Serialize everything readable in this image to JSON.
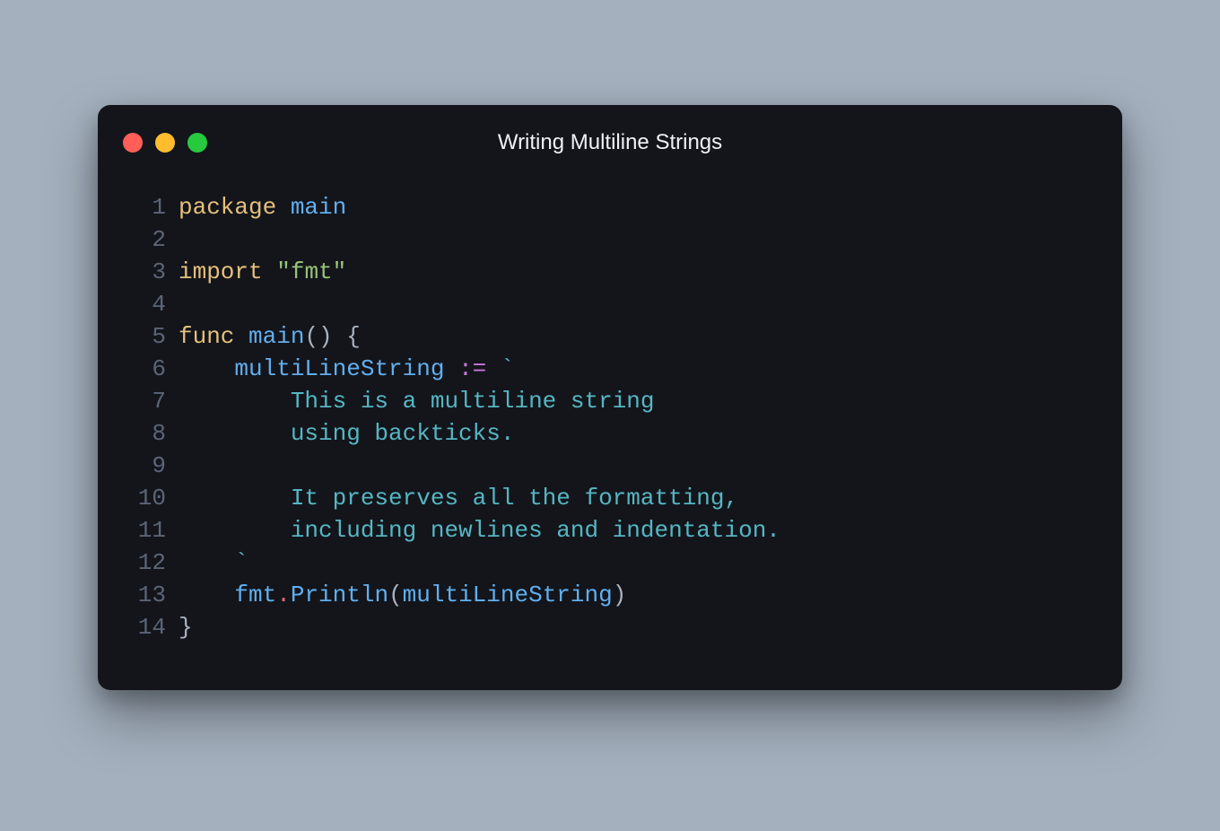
{
  "window": {
    "title": "Writing Multiline Strings",
    "traffic_light_colors": {
      "close": "#ff5f56",
      "minimize": "#ffbd2e",
      "zoom": "#27c93f"
    }
  },
  "code": {
    "language": "go",
    "lines": [
      {
        "n": "1",
        "tokens": [
          {
            "cls": "tok-kw",
            "t": "package"
          },
          {
            "cls": "tok-plain",
            "t": " "
          },
          {
            "cls": "tok-id",
            "t": "main"
          }
        ]
      },
      {
        "n": "2",
        "tokens": []
      },
      {
        "n": "3",
        "tokens": [
          {
            "cls": "tok-kw",
            "t": "import"
          },
          {
            "cls": "tok-plain",
            "t": " "
          },
          {
            "cls": "tok-str",
            "t": "\"fmt\""
          }
        ]
      },
      {
        "n": "4",
        "tokens": []
      },
      {
        "n": "5",
        "tokens": [
          {
            "cls": "tok-kw",
            "t": "func"
          },
          {
            "cls": "tok-plain",
            "t": " "
          },
          {
            "cls": "tok-id",
            "t": "main"
          },
          {
            "cls": "tok-pun",
            "t": "() {"
          }
        ]
      },
      {
        "n": "6",
        "tokens": [
          {
            "cls": "tok-plain",
            "t": "    "
          },
          {
            "cls": "tok-id",
            "t": "multiLineString"
          },
          {
            "cls": "tok-plain",
            "t": " "
          },
          {
            "cls": "tok-op",
            "t": ":="
          },
          {
            "cls": "tok-plain",
            "t": " "
          },
          {
            "cls": "tok-lit",
            "t": "`"
          }
        ]
      },
      {
        "n": "7",
        "tokens": [
          {
            "cls": "tok-lit",
            "t": "        This is a multiline string"
          }
        ]
      },
      {
        "n": "8",
        "tokens": [
          {
            "cls": "tok-lit",
            "t": "        using backticks."
          }
        ]
      },
      {
        "n": "9",
        "tokens": []
      },
      {
        "n": "10",
        "tokens": [
          {
            "cls": "tok-lit",
            "t": "        It preserves all the formatting,"
          }
        ]
      },
      {
        "n": "11",
        "tokens": [
          {
            "cls": "tok-lit",
            "t": "        including newlines and indentation."
          }
        ]
      },
      {
        "n": "12",
        "tokens": [
          {
            "cls": "tok-lit",
            "t": "    `"
          }
        ]
      },
      {
        "n": "13",
        "tokens": [
          {
            "cls": "tok-plain",
            "t": "    "
          },
          {
            "cls": "tok-id",
            "t": "fmt"
          },
          {
            "cls": "tok-dot",
            "t": "."
          },
          {
            "cls": "tok-id",
            "t": "Println"
          },
          {
            "cls": "tok-pun",
            "t": "("
          },
          {
            "cls": "tok-id",
            "t": "multiLineString"
          },
          {
            "cls": "tok-pun",
            "t": ")"
          }
        ]
      },
      {
        "n": "14",
        "tokens": [
          {
            "cls": "tok-pun",
            "t": "}"
          }
        ]
      }
    ]
  }
}
